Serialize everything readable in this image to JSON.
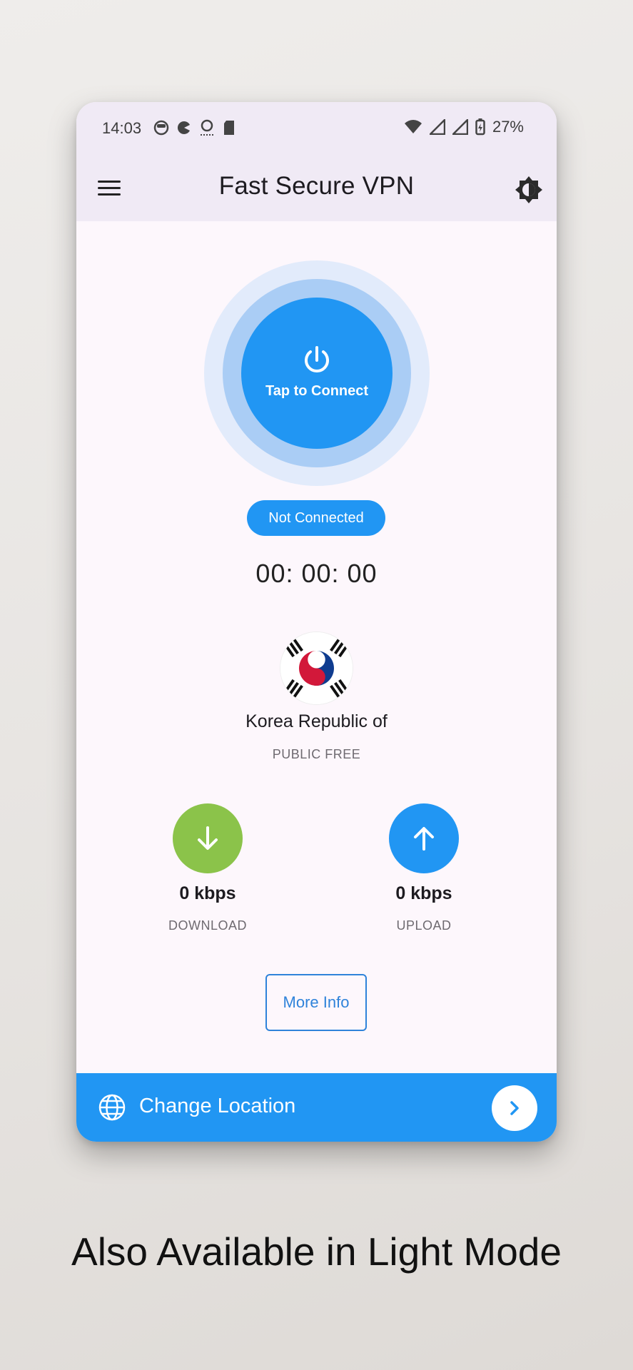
{
  "statusbar": {
    "time": "14:03",
    "battery": "27%",
    "icons": [
      "face-icon",
      "pacman-icon",
      "accessibility-icon",
      "sd-card-icon",
      "wifi-icon",
      "signal-icon",
      "signal-icon",
      "battery-icon"
    ]
  },
  "appbar": {
    "title": "Fast Secure VPN",
    "menu_icon": "menu-icon",
    "theme_icon": "brightness-icon"
  },
  "connect": {
    "label": "Tap to Connect",
    "icon": "power-icon",
    "status": "Not Connected",
    "timer": "00: 00: 00"
  },
  "server": {
    "country": "Korea Republic of",
    "type": "PUBLIC FREE",
    "flag_icon": "south-korea-flag-icon"
  },
  "stats": {
    "download": {
      "speed": "0 kbps",
      "label": "DOWNLOAD",
      "color": "#8bc34a",
      "icon": "arrow-down-icon"
    },
    "upload": {
      "speed": "0 kbps",
      "label": "UPLOAD",
      "color": "#2196f3",
      "icon": "arrow-up-icon"
    }
  },
  "more_info_label": "More Info",
  "bottom_bar": {
    "label": "Change Location",
    "globe_icon": "globe-icon",
    "arrow_icon": "chevron-right-icon"
  },
  "caption": "Also Available in Light Mode",
  "colors": {
    "accent": "#2196f3",
    "download": "#8bc34a",
    "appbar_bg": "#f0eaf5",
    "screen_bg": "#fdf7fc"
  }
}
